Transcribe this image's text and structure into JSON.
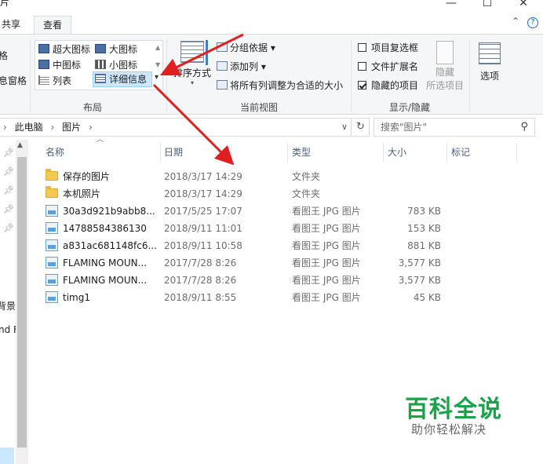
{
  "title_bar": {
    "title_fragment": "片",
    "minimize": "—",
    "maximize": "☐",
    "close": "✕"
  },
  "tabs": [
    {
      "label": "共享"
    },
    {
      "label": "查看",
      "active": true
    }
  ],
  "ribbon_help": "⌃",
  "left_cut": [
    "格",
    "息窗格"
  ],
  "ribbon": {
    "layout": {
      "items": [
        {
          "label": "超大图标",
          "icon": "extra-large-icons-icon"
        },
        {
          "label": "大图标",
          "icon": "large-icons-icon"
        },
        {
          "label": "中图标",
          "icon": "medium-icons-icon"
        },
        {
          "label": "小图标",
          "icon": "small-icons-icon"
        },
        {
          "label": "列表",
          "icon": "list-icon"
        },
        {
          "label": "详细信息",
          "icon": "details-icon",
          "selected": true
        }
      ],
      "group_label": "布局"
    },
    "current_view": {
      "sort_label": "排序方式",
      "group_by": "分组依据 ▾",
      "add_column": "添加列 ▾",
      "fit_columns": "将所有列调整为合适的大小",
      "group_label": "当前视图"
    },
    "show_hide": {
      "item_checkboxes": {
        "label": "项目复选框",
        "checked": false
      },
      "file_extensions": {
        "label": "文件扩展名",
        "checked": false
      },
      "hidden_items": {
        "label": "隐藏的项目",
        "checked": true
      },
      "hide_selected_label_1": "隐藏",
      "hide_selected_label_2": "所选项目",
      "group_label": "显示/隐藏"
    },
    "options_label": "选项"
  },
  "address": {
    "breadcrumb": [
      "此电脑",
      "图片"
    ],
    "search_placeholder": "搜索\"图片\""
  },
  "nav": {
    "texts": [
      "背景",
      "nd F"
    ]
  },
  "columns": [
    {
      "label": "名称"
    },
    {
      "label": "日期"
    },
    {
      "label": "类型"
    },
    {
      "label": "大小"
    },
    {
      "label": "标记"
    }
  ],
  "files": [
    {
      "name": "保存的图片",
      "date": "2018/3/17 14:29",
      "type": "文件夹",
      "size": "",
      "kind": "folder"
    },
    {
      "name": "本机照片",
      "date": "2018/3/17 14:29",
      "type": "文件夹",
      "size": "",
      "kind": "folder"
    },
    {
      "name": "30a3d921b9abb8...",
      "date": "2017/5/25 17:07",
      "type": "看图王 JPG 图片",
      "size": "783 KB",
      "kind": "jpg"
    },
    {
      "name": "14788584386130",
      "date": "2018/9/11 11:01",
      "type": "看图王 JPG 图片",
      "size": "153 KB",
      "kind": "jpg"
    },
    {
      "name": "a831ac681148fc6...",
      "date": "2018/9/11 10:58",
      "type": "看图王 JPG 图片",
      "size": "881 KB",
      "kind": "jpg"
    },
    {
      "name": "FLAMING MOUN...",
      "date": "2017/7/28 8:26",
      "type": "看图王 JPG 图片",
      "size": "3,577 KB",
      "kind": "jpg"
    },
    {
      "name": "FLAMING MOUN...",
      "date": "2017/7/28 8:26",
      "type": "看图王 JPG 图片",
      "size": "3,577 KB",
      "kind": "jpg"
    },
    {
      "name": "timg1",
      "date": "2018/9/11 8:55",
      "type": "看图王 JPG 图片",
      "size": "45 KB",
      "kind": "jpg"
    }
  ],
  "watermark": {
    "title": "百科全说",
    "subtitle": "助你轻松解决"
  },
  "colors": {
    "accent": "#0078d7",
    "selected_bg": "#cce8ff",
    "arrow": "#e02020",
    "watermark": "#1aa34a"
  }
}
